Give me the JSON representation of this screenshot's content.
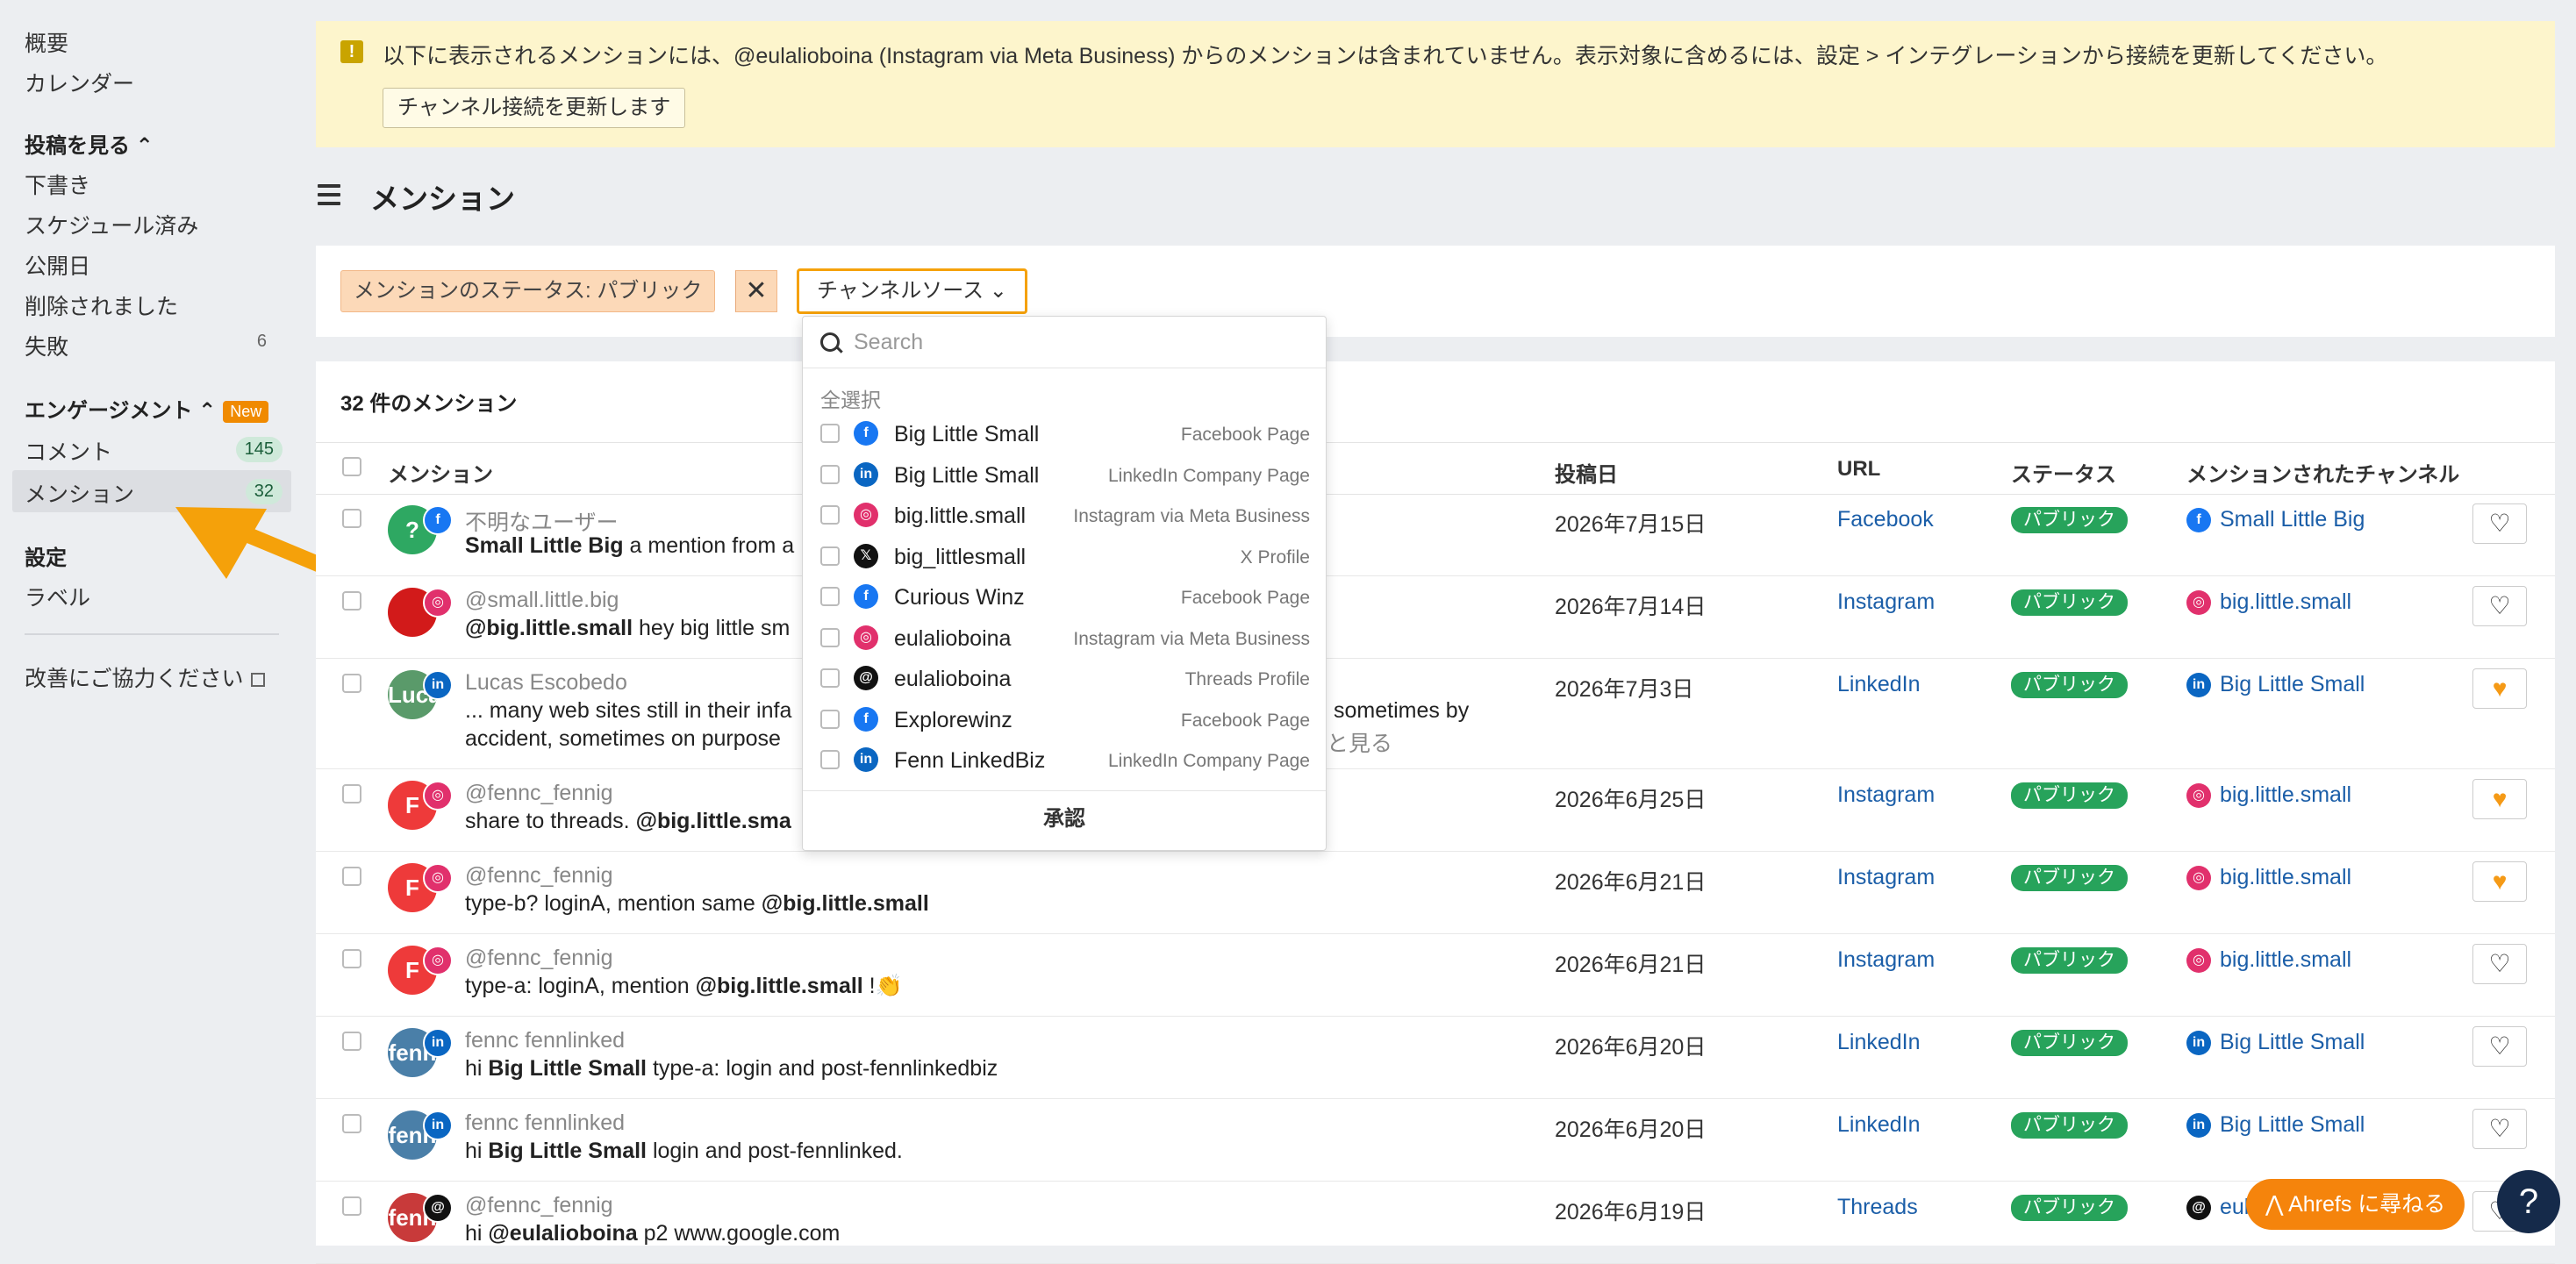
{
  "sidebar": {
    "overview": "概要",
    "calendar": "カレンダー",
    "posts_heading": "投稿を見る ⌃",
    "drafts": "下書き",
    "scheduled": "スケジュール済み",
    "published": "公開日",
    "deleted": "削除されました",
    "failed": "失敗",
    "failed_count": "6",
    "engagement_heading": "エンゲージメント ⌃",
    "new_badge": "New",
    "comments": "コメント",
    "comments_count": "145",
    "mentions": "メンション",
    "mentions_count": "32",
    "settings_heading": "設定",
    "labels": "ラベル",
    "feedback": "改善にご協力ください"
  },
  "banner": {
    "text": "以下に表示されるメンションには、@eulalioboina (Instagram via Meta Business) からのメンションは含まれていません。表示対象に含めるには、設定 > インテグレーションから接続を更新してください。",
    "button": "チャンネル接続を更新します"
  },
  "page": {
    "title": "メンション"
  },
  "filters": {
    "status_chip": "メンションのステータス: パブリック",
    "remove": "✕",
    "channel_source": "チャンネルソース ⌄"
  },
  "dropdown": {
    "search_placeholder": "Search",
    "select_all": "全選択",
    "approve": "承認",
    "items": [
      {
        "name": "Big Little Small",
        "type": "Facebook Page",
        "icon": "facebook-icon",
        "glyph": "f"
      },
      {
        "name": "Big Little Small",
        "type": "LinkedIn Company Page",
        "icon": "linkedin-icon",
        "glyph": "in"
      },
      {
        "name": "big.little.small",
        "type": "Instagram via Meta Business",
        "icon": "instagram-icon",
        "glyph": "◎"
      },
      {
        "name": "big_littlesmall",
        "type": "X Profile",
        "icon": "x-icon",
        "glyph": "𝕏"
      },
      {
        "name": "Curious Winz",
        "type": "Facebook Page",
        "icon": "facebook-icon",
        "glyph": "f"
      },
      {
        "name": "eulalioboina",
        "type": "Instagram via Meta Business",
        "icon": "instagram-icon",
        "glyph": "◎"
      },
      {
        "name": "eulalioboina",
        "type": "Threads Profile",
        "icon": "threads-icon",
        "glyph": "@"
      },
      {
        "name": "Explorewinz",
        "type": "Facebook Page",
        "icon": "facebook-icon",
        "glyph": "f"
      },
      {
        "name": "Fenn LinkedBiz",
        "type": "LinkedIn Company Page",
        "icon": "linkedin-icon",
        "glyph": "in"
      }
    ]
  },
  "list": {
    "count_title": "32 件のメンション",
    "headers": {
      "mention": "メンション",
      "date": "投稿日",
      "url": "URL",
      "status": "ステータス",
      "channel": "メンションされたチャンネル"
    },
    "rows": [
      {
        "author": "不明なユーザー",
        "avatar": "?",
        "avatar_color": "#2ea862",
        "badge": "f",
        "badge_icon": "facebook-icon",
        "bold": "Small Little Big",
        "text": " a mention from a",
        "line2": "",
        "date": "2026年7月15日",
        "url": "Facebook",
        "status": "パブリック",
        "channel": "Small Little Big",
        "ch_glyph": "f",
        "ch_class": "ic-fb",
        "liked": false
      },
      {
        "author": "@small.little.big",
        "avatar": "",
        "avatar_color": "#d21a1a",
        "badge": "◎",
        "badge_icon": "instagram-icon",
        "bold": "@big.little.small",
        "text": " hey big little sm",
        "line2": "",
        "date": "2026年7月14日",
        "url": "Instagram",
        "status": "パブリック",
        "channel": "big.little.small",
        "ch_glyph": "◎",
        "ch_class": "ic-ig",
        "liked": false
      },
      {
        "author": "Lucas Escobedo",
        "avatar": "Luca",
        "avatar_color": "#5a9a6a",
        "badge": "in",
        "badge_icon": "linkedin-icon",
        "bold": "",
        "text": "... many web sites still in their infa",
        "line2": "accident, sometimes on purpose",
        "trail1": "sometimes by",
        "trail2": "と見る",
        "date": "2026年7月3日",
        "url": "LinkedIn",
        "status": "パブリック",
        "channel": "Big Little Small",
        "ch_glyph": "in",
        "ch_class": "ic-li",
        "liked": true
      },
      {
        "author": "@fennc_fennig",
        "avatar": "F",
        "avatar_color": "#ee3a3a",
        "badge": "◎",
        "badge_icon": "instagram-icon",
        "bold": "",
        "text": "share to threads. ",
        "bold2": "@big.little.sma",
        "line2": "",
        "date": "2026年6月25日",
        "url": "Instagram",
        "status": "パブリック",
        "channel": "big.little.small",
        "ch_glyph": "◎",
        "ch_class": "ic-ig",
        "liked": true
      },
      {
        "author": "@fennc_fennig",
        "avatar": "F",
        "avatar_color": "#ee3a3a",
        "badge": "◎",
        "badge_icon": "instagram-icon",
        "bold": "",
        "text": "type-b? loginA, mention same ",
        "bold2": "@big.little.small",
        "line2": "",
        "date": "2026年6月21日",
        "url": "Instagram",
        "status": "パブリック",
        "channel": "big.little.small",
        "ch_glyph": "◎",
        "ch_class": "ic-ig",
        "liked": true
      },
      {
        "author": "@fennc_fennig",
        "avatar": "F",
        "avatar_color": "#ee3a3a",
        "badge": "◎",
        "badge_icon": "instagram-icon",
        "bold": "",
        "text": "type-a: loginA, mention ",
        "bold2": "@big.little.small",
        "tail": " !👏",
        "line2": "",
        "date": "2026年6月21日",
        "url": "Instagram",
        "status": "パブリック",
        "channel": "big.little.small",
        "ch_glyph": "◎",
        "ch_class": "ic-ig",
        "liked": false
      },
      {
        "author": "fennc fennlinked",
        "avatar": "fenn",
        "avatar_color": "#4a7fa8",
        "badge": "in",
        "badge_icon": "linkedin-icon",
        "bold": "",
        "text": "hi ",
        "bold2": "Big Little Small",
        "tail": " type-a: login and post-fennlinkedbiz",
        "line2": "",
        "date": "2026年6月20日",
        "url": "LinkedIn",
        "status": "パブリック",
        "channel": "Big Little Small",
        "ch_glyph": "in",
        "ch_class": "ic-li",
        "liked": false
      },
      {
        "author": "fennc fennlinked",
        "avatar": "fenn",
        "avatar_color": "#4a7fa8",
        "badge": "in",
        "badge_icon": "linkedin-icon",
        "bold": "",
        "text": "hi ",
        "bold2": "Big Little Small",
        "tail": " login and post-fennlinked.",
        "line2": "",
        "date": "2026年6月20日",
        "url": "LinkedIn",
        "status": "パブリック",
        "channel": "Big Little Small",
        "ch_glyph": "in",
        "ch_class": "ic-li",
        "liked": false
      },
      {
        "author": "@fennc_fennig",
        "avatar": "fenn",
        "avatar_color": "#c83a3a",
        "badge": "@",
        "badge_icon": "threads-icon",
        "bold": "",
        "text": "hi ",
        "bold2": "@eulalioboina",
        "tail": " p2 www.google.com",
        "line2": "",
        "date": "2026年6月19日",
        "url": "Threads",
        "status": "パブリック",
        "channel": "eula",
        "ch_glyph": "@",
        "ch_class": "ic-th",
        "liked": false
      }
    ]
  },
  "floating": {
    "ahrefs": "⋀  Ahrefs に尋ねる",
    "help": "?"
  },
  "colors": {
    "accent_orange": "#f5a10a",
    "status_green": "#27a35b",
    "link_blue": "#1b5ea8",
    "banner_yellow": "#fdf5cc"
  }
}
